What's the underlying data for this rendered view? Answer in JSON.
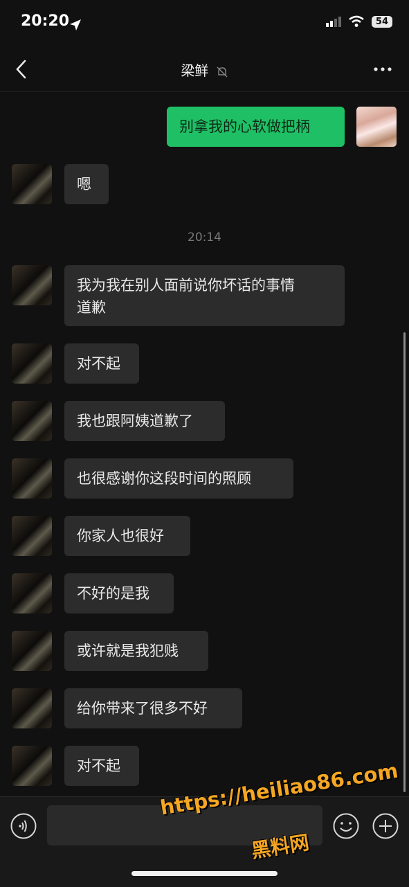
{
  "status_bar": {
    "time": "20:20",
    "battery": "54"
  },
  "header": {
    "title": "梁鲜"
  },
  "conversation": {
    "outgoing": [
      {
        "text": "别拿我的心软做把柄"
      }
    ],
    "incoming_first": {
      "text": "嗯"
    },
    "timestamp": "20:14",
    "incoming": [
      {
        "text": "我为我在别人面前说你坏话的事情\n道歉"
      },
      {
        "text": "对不起"
      },
      {
        "text": "我也跟阿姨道歉了"
      },
      {
        "text": "也很感谢你这段时间的照顾"
      },
      {
        "text": "你家人也很好"
      },
      {
        "text": "不好的是我"
      },
      {
        "text": "或许就是我犯贱"
      },
      {
        "text": "给你带来了很多不好"
      },
      {
        "text": "对不起"
      }
    ]
  },
  "input_bar": {
    "message_value": ""
  },
  "watermark": {
    "url": "https://heiliao86.com",
    "name": "黑料网"
  },
  "colors": {
    "outgoing_bubble": "#1fc065",
    "incoming_bubble": "#2c2c2c",
    "background": "#111111",
    "watermark": "#f5a623"
  }
}
